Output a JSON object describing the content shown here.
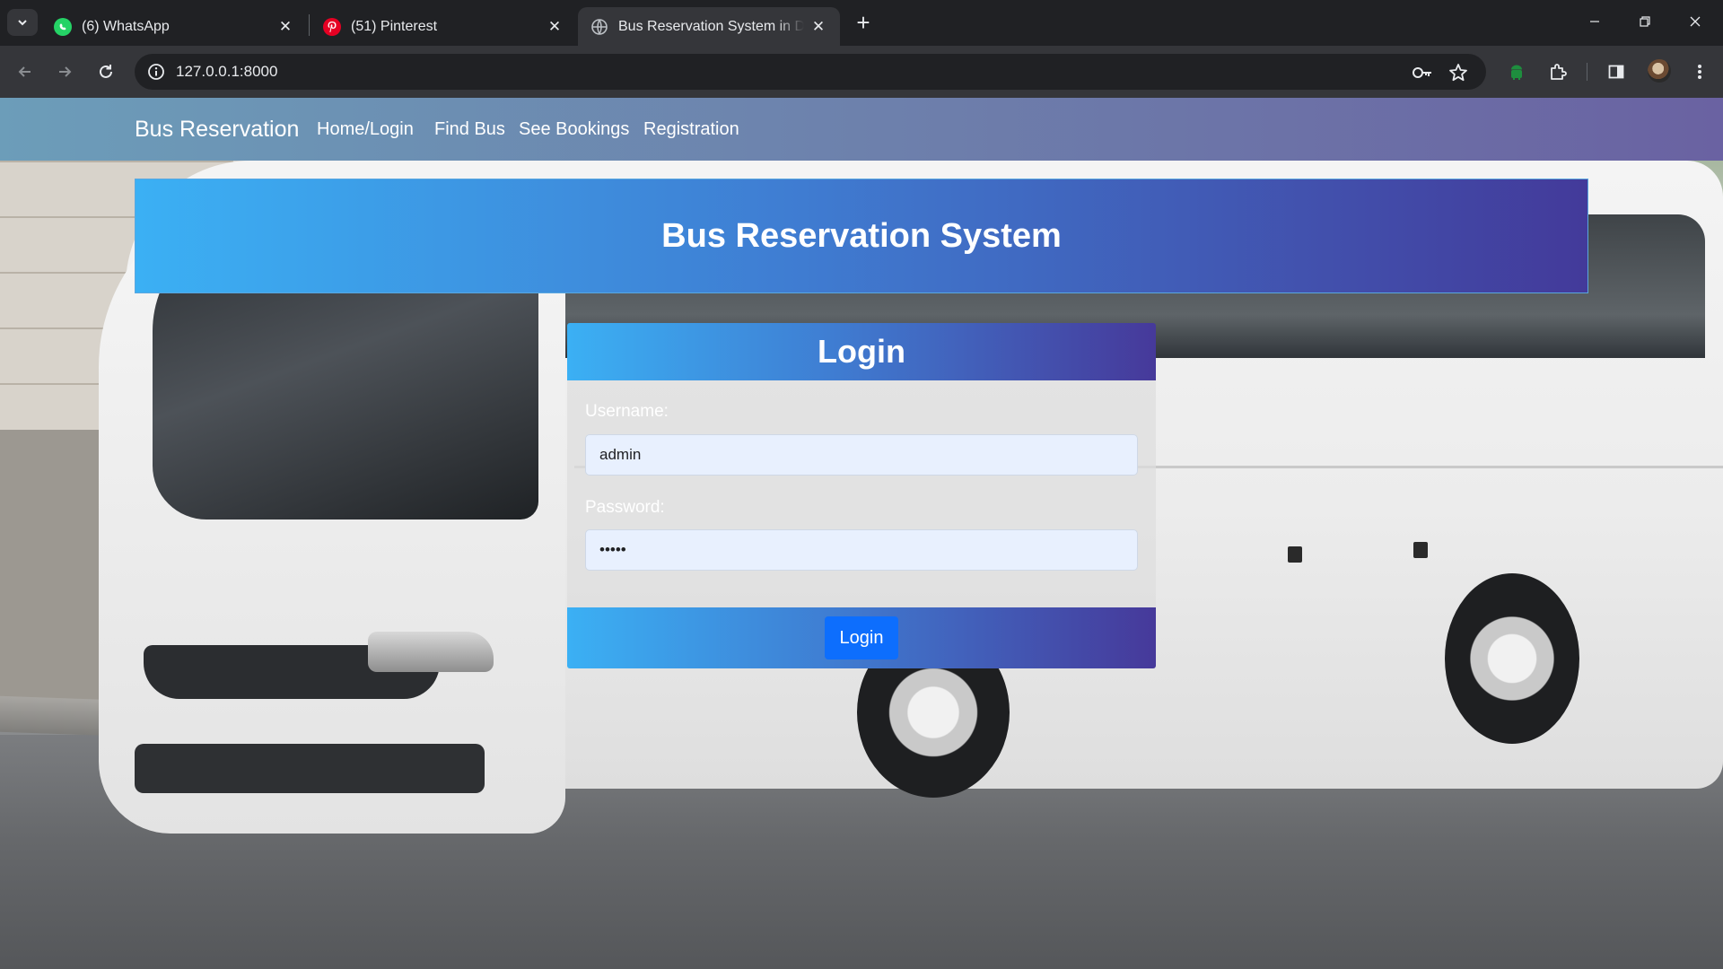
{
  "browser": {
    "tabs": [
      {
        "title": "(6) WhatsApp",
        "icon": "whatsapp-icon",
        "active": false
      },
      {
        "title": "(51) Pinterest",
        "icon": "pinterest-icon",
        "active": false
      },
      {
        "title": "Bus Reservation System in Djan",
        "icon": "globe-icon",
        "active": true
      }
    ],
    "address": "127.0.0.1:8000"
  },
  "nav": {
    "brand": "Bus Reservation",
    "links": [
      "Home/Login",
      "Find Bus",
      "See Bookings",
      "Registration"
    ]
  },
  "banner": {
    "title": "Bus Reservation System"
  },
  "login": {
    "title": "Login",
    "username_label": "Username:",
    "username_value": "admin",
    "password_label": "Password:",
    "password_value": "•••••",
    "submit_label": "Login"
  },
  "colors": {
    "nav_gradient": [
      "#6c9db9",
      "#6a62a2"
    ],
    "banner_gradient": [
      "#3bb0f4",
      "#433a9a"
    ],
    "button": "#0d6efd",
    "input_bg": "#e8f0fe"
  }
}
